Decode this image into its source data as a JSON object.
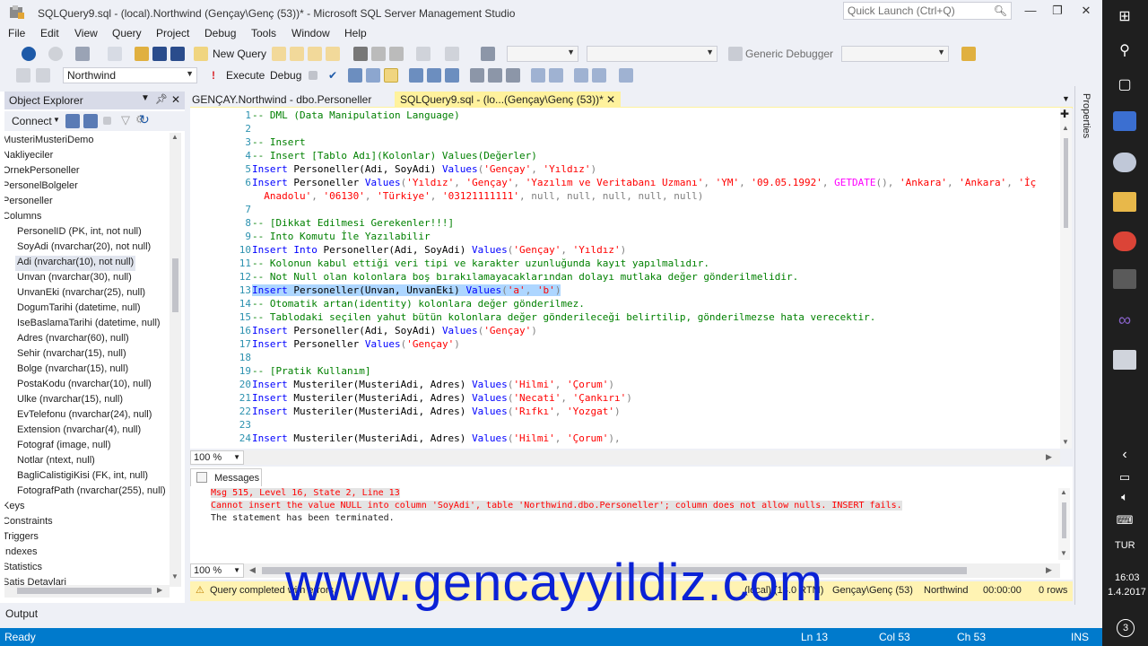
{
  "window": {
    "title": "SQLQuery9.sql - (local).Northwind (Gençay\\Genç (53))* - Microsoft SQL Server Management Studio",
    "quick_launch_placeholder": "Quick Launch (Ctrl+Q)"
  },
  "menu": [
    "File",
    "Edit",
    "View",
    "Query",
    "Project",
    "Debug",
    "Tools",
    "Window",
    "Help"
  ],
  "toolbar": {
    "new_query": "New Query",
    "debugger": "Generic Debugger",
    "database": "Northwind",
    "execute": "Execute",
    "debug": "Debug"
  },
  "object_explorer": {
    "title": "Object Explorer",
    "connect": "Connect",
    "items": [
      {
        "text": "MusteriMusteriDemo",
        "indent": 0
      },
      {
        "text": "Nakliyeciler",
        "indent": 0
      },
      {
        "text": "OrnekPersoneller",
        "indent": 0
      },
      {
        "text": "PersonelBolgeler",
        "indent": 0
      },
      {
        "text": "Personeller",
        "indent": 0
      },
      {
        "text": "Columns",
        "indent": 0
      },
      {
        "text": "PersonelID (PK, int, not null)",
        "indent": 1
      },
      {
        "text": "SoyAdi (nvarchar(20), not null)",
        "indent": 1
      },
      {
        "text": "Adi (nvarchar(10), not null)",
        "indent": 1,
        "selected": true
      },
      {
        "text": "Unvan (nvarchar(30), null)",
        "indent": 1
      },
      {
        "text": "UnvanEki (nvarchar(25), null)",
        "indent": 1
      },
      {
        "text": "DogumTarihi (datetime, null)",
        "indent": 1
      },
      {
        "text": "IseBaslamaTarihi (datetime, null)",
        "indent": 1
      },
      {
        "text": "Adres (nvarchar(60), null)",
        "indent": 1
      },
      {
        "text": "Sehir (nvarchar(15), null)",
        "indent": 1
      },
      {
        "text": "Bolge (nvarchar(15), null)",
        "indent": 1
      },
      {
        "text": "PostaKodu (nvarchar(10), null)",
        "indent": 1
      },
      {
        "text": "Ulke (nvarchar(15), null)",
        "indent": 1
      },
      {
        "text": "EvTelefonu (nvarchar(24), null)",
        "indent": 1
      },
      {
        "text": "Extension (nvarchar(4), null)",
        "indent": 1
      },
      {
        "text": "Fotograf (image, null)",
        "indent": 1
      },
      {
        "text": "Notlar (ntext, null)",
        "indent": 1
      },
      {
        "text": "BagliCalistigiKisi (FK, int, null)",
        "indent": 1
      },
      {
        "text": "FotografPath (nvarchar(255), null)",
        "indent": 1
      },
      {
        "text": "Keys",
        "indent": 0
      },
      {
        "text": "Constraints",
        "indent": 0
      },
      {
        "text": "Triggers",
        "indent": 0
      },
      {
        "text": "Indexes",
        "indent": 0
      },
      {
        "text": "Statistics",
        "indent": 0
      },
      {
        "text": "Satis Detaylari",
        "indent": 0
      }
    ]
  },
  "tabs": [
    {
      "label": "GENÇAY.Northwind - dbo.Personeller",
      "active": false
    },
    {
      "label": "SQLQuery9.sql - (lo...(Gençay\\Genç (53))*",
      "active": true
    }
  ],
  "editor": {
    "zoom": "100 %",
    "lines": [
      {
        "n": "1",
        "spans": [
          [
            "cm",
            "-- DML (Data Manipulation Language)"
          ]
        ]
      },
      {
        "n": "2",
        "spans": []
      },
      {
        "n": "3",
        "spans": [
          [
            "cm",
            "-- Insert"
          ]
        ]
      },
      {
        "n": "4",
        "spans": [
          [
            "cm",
            "-- Insert [Tablo Adı](Kolonlar) Values(Değerler)"
          ]
        ]
      },
      {
        "n": "5",
        "spans": [
          [
            "kw",
            "Insert"
          ],
          [
            "",
            " Personeller(Adi, SoyAdi) "
          ],
          [
            "kw",
            "Values"
          ],
          [
            "gr",
            "("
          ],
          [
            "st",
            "'Gençay'"
          ],
          [
            "gr",
            ", "
          ],
          [
            "st",
            "'Yıldız'"
          ],
          [
            "gr",
            ")"
          ]
        ]
      },
      {
        "n": "6",
        "spans": [
          [
            "kw",
            "Insert"
          ],
          [
            "",
            " Personeller "
          ],
          [
            "kw",
            "Values"
          ],
          [
            "gr",
            "("
          ],
          [
            "st",
            "'Yıldız'"
          ],
          [
            "gr",
            ", "
          ],
          [
            "st",
            "'Gençay'"
          ],
          [
            "gr",
            ", "
          ],
          [
            "st",
            "'Yazılım ve Veritabanı Uzmanı'"
          ],
          [
            "gr",
            ", "
          ],
          [
            "st",
            "'YM'"
          ],
          [
            "gr",
            ", "
          ],
          [
            "st",
            "'09.05.1992'"
          ],
          [
            "gr",
            ", "
          ],
          [
            "fn",
            "GETDATE"
          ],
          [
            "gr",
            "(), "
          ],
          [
            "st",
            "'Ankara'"
          ],
          [
            "gr",
            ", "
          ],
          [
            "st",
            "'Ankara'"
          ],
          [
            "gr",
            ", "
          ],
          [
            "st",
            "'İç"
          ]
        ]
      },
      {
        "n": "",
        "spans": [
          [
            "st",
            "  Anadolu'"
          ],
          [
            "gr",
            ", "
          ],
          [
            "st",
            "'06130'"
          ],
          [
            "gr",
            ", "
          ],
          [
            "st",
            "'Türkiye'"
          ],
          [
            "gr",
            ", "
          ],
          [
            "st",
            "'03121111111'"
          ],
          [
            "gr",
            ", null, null, null, null, null)"
          ]
        ]
      },
      {
        "n": "7",
        "spans": []
      },
      {
        "n": "8",
        "spans": [
          [
            "cm",
            "-- [Dikkat Edilmesi Gerekenler!!!]"
          ]
        ]
      },
      {
        "n": "9",
        "spans": [
          [
            "cm",
            "-- Into Komutu İle Yazılabilir"
          ]
        ]
      },
      {
        "n": "10",
        "spans": [
          [
            "kw",
            "Insert Into"
          ],
          [
            "",
            " Personeller(Adi, SoyAdi) "
          ],
          [
            "kw",
            "Values"
          ],
          [
            "gr",
            "("
          ],
          [
            "st",
            "'Gençay'"
          ],
          [
            "gr",
            ", "
          ],
          [
            "st",
            "'Yıldız'"
          ],
          [
            "gr",
            ")"
          ]
        ]
      },
      {
        "n": "11",
        "spans": [
          [
            "cm",
            "-- Kolonun kabul ettiği veri tipi ve karakter uzunluğunda kayıt yapılmalıdır."
          ]
        ]
      },
      {
        "n": "12",
        "spans": [
          [
            "cm",
            "-- Not Null olan kolonlara boş bırakılamayacaklarından dolayı mutlaka değer gönderilmelidir."
          ]
        ]
      },
      {
        "n": "13",
        "hl": true,
        "spans": [
          [
            "kw",
            "Insert"
          ],
          [
            "",
            " Personeller(Unvan, UnvanEki) "
          ],
          [
            "kw",
            "Values"
          ],
          [
            "gr",
            "("
          ],
          [
            "st",
            "'a'"
          ],
          [
            "gr",
            ", "
          ],
          [
            "st",
            "'b'"
          ],
          [
            "gr",
            ")"
          ]
        ]
      },
      {
        "n": "14",
        "spans": [
          [
            "cm",
            "-- Otomatik artan(identity) kolonlara değer gönderilmez."
          ]
        ]
      },
      {
        "n": "15",
        "spans": [
          [
            "cm",
            "-- Tablodaki seçilen yahut bütün kolonlara değer gönderileceği belirtilip, gönderilmezse hata verecektir."
          ]
        ]
      },
      {
        "n": "16",
        "spans": [
          [
            "kw",
            "Insert"
          ],
          [
            "",
            " Personeller(Adi, SoyAdi) "
          ],
          [
            "kw",
            "Values"
          ],
          [
            "gr",
            "("
          ],
          [
            "st",
            "'Gençay'"
          ],
          [
            "gr",
            ")"
          ]
        ]
      },
      {
        "n": "17",
        "spans": [
          [
            "kw",
            "Insert"
          ],
          [
            "",
            " Personeller "
          ],
          [
            "kw",
            "Values"
          ],
          [
            "gr",
            "("
          ],
          [
            "st",
            "'Gençay'"
          ],
          [
            "gr",
            ")"
          ]
        ]
      },
      {
        "n": "18",
        "spans": []
      },
      {
        "n": "19",
        "spans": [
          [
            "cm",
            "-- [Pratik Kullanım]"
          ]
        ]
      },
      {
        "n": "20",
        "spans": [
          [
            "kw",
            "Insert"
          ],
          [
            "",
            " Musteriler(MusteriAdi, Adres) "
          ],
          [
            "kw",
            "Values"
          ],
          [
            "gr",
            "("
          ],
          [
            "st",
            "'Hilmi'"
          ],
          [
            "gr",
            ", "
          ],
          [
            "st",
            "'Çorum'"
          ],
          [
            "gr",
            ")"
          ]
        ]
      },
      {
        "n": "21",
        "spans": [
          [
            "kw",
            "Insert"
          ],
          [
            "",
            " Musteriler(MusteriAdi, Adres) "
          ],
          [
            "kw",
            "Values"
          ],
          [
            "gr",
            "("
          ],
          [
            "st",
            "'Necati'"
          ],
          [
            "gr",
            ", "
          ],
          [
            "st",
            "'Çankırı'"
          ],
          [
            "gr",
            ")"
          ]
        ]
      },
      {
        "n": "22",
        "spans": [
          [
            "kw",
            "Insert"
          ],
          [
            "",
            " Musteriler(MusteriAdi, Adres) "
          ],
          [
            "kw",
            "Values"
          ],
          [
            "gr",
            "("
          ],
          [
            "st",
            "'Rıfkı'"
          ],
          [
            "gr",
            ", "
          ],
          [
            "st",
            "'Yozgat'"
          ],
          [
            "gr",
            ")"
          ]
        ]
      },
      {
        "n": "23",
        "spans": []
      },
      {
        "n": "24",
        "spans": [
          [
            "kw",
            "Insert"
          ],
          [
            "",
            " Musteriler(MusteriAdi, Adres) "
          ],
          [
            "kw",
            "Values"
          ],
          [
            "gr",
            "("
          ],
          [
            "st",
            "'Hilmi'"
          ],
          [
            "gr",
            ", "
          ],
          [
            "st",
            "'Çorum'"
          ],
          [
            "gr",
            "),"
          ]
        ]
      }
    ]
  },
  "results": {
    "tab": "Messages",
    "zoom": "100 %",
    "lines": [
      {
        "cls": "err",
        "text": "Msg 515, Level 16, State 2, Line 13"
      },
      {
        "cls": "err",
        "text": "Cannot insert the value NULL into column 'SoyAdi', table 'Northwind.dbo.Personeller'; column does not allow nulls. INSERT fails."
      },
      {
        "cls": "",
        "text": "The statement has been terminated."
      }
    ]
  },
  "query_status": {
    "message": "Query completed with errors.",
    "server": "(local) (13.0 RTM)",
    "user": "Gençay\\Genç (53)",
    "database": "Northwind",
    "time": "00:00:00",
    "rows": "0 rows"
  },
  "output_label": "Output",
  "properties_label": "Properties",
  "statusbar": {
    "ready": "Ready",
    "ln": "Ln 13",
    "col": "Col 53",
    "ch": "Ch 53",
    "ins": "INS"
  },
  "taskbar": {
    "lang": "TUR",
    "time": "16:03",
    "date": "1.4.2017",
    "notif_count": "3"
  },
  "watermark": "www.gencayyildiz.com",
  "colors": {
    "accent": "#007acc",
    "comment": "#008000",
    "keyword": "#0000ff",
    "string": "#ff0000",
    "watermark": "#0b22d6"
  }
}
